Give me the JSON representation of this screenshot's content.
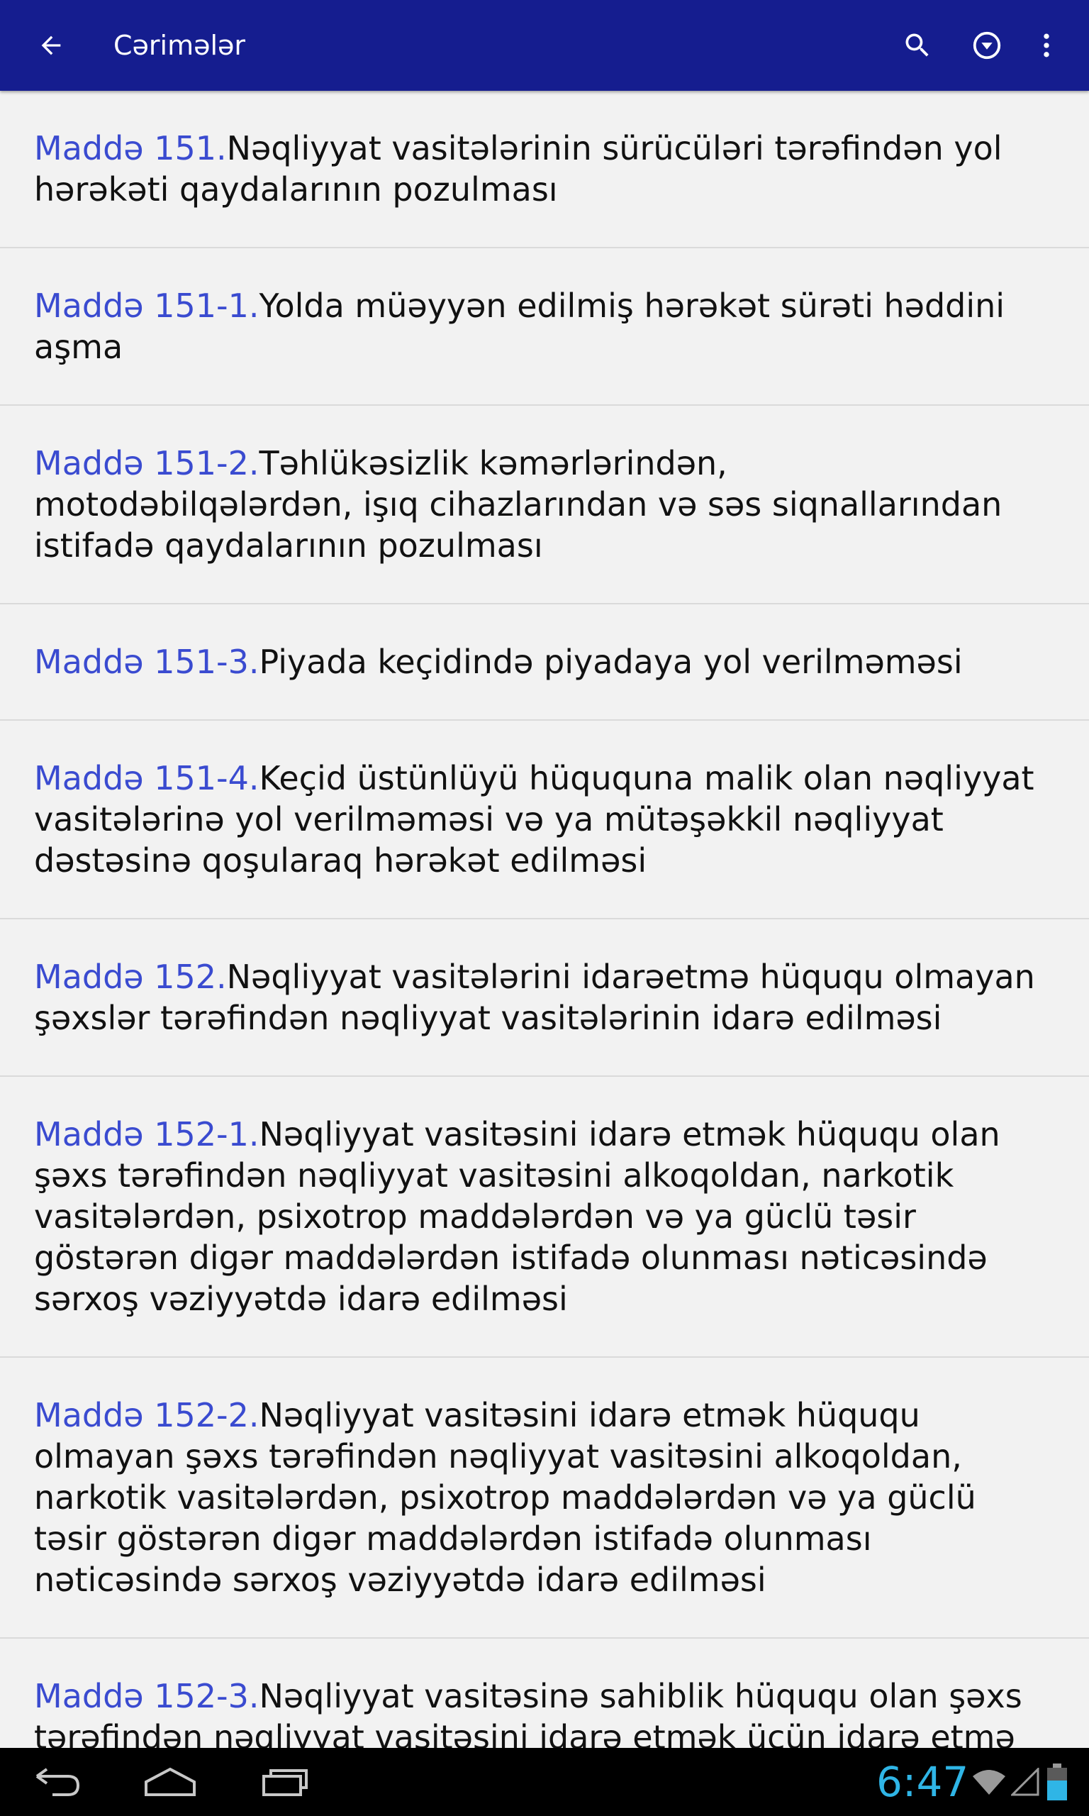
{
  "app_bar": {
    "title": "Cərimələr",
    "color": "#151d8f",
    "icons": [
      "back-arrow-icon",
      "search-icon",
      "filter-dropdown-icon",
      "more-vert-icon"
    ]
  },
  "articles": [
    {
      "number": "Maddə 151.",
      "text": "Nəqliyyat vasitələrinin sürücüləri tərəfindən yol hərəkəti qaydalarının pozulması"
    },
    {
      "number": "Maddə 151-1.",
      "text": "Yolda müəyyən edilmiş hərəkət sürəti həddini aşma"
    },
    {
      "number": "Maddə 151-2.",
      "text": "Təhlükəsizlik kəmərlərindən, motodəbilqələrdən, işıq cihazlarından və səs siqnallarından istifadə qaydalarının pozulması"
    },
    {
      "number": "Maddə 151-3.",
      "text": "Piyada keçidində piyadaya yol verilməməsi"
    },
    {
      "number": "Maddə 151-4.",
      "text": "Keçid üstünlüyü hüququna malik olan nəqliyyat vasitələrinə yol verilməməsi və ya mütəşəkkil nəqliyyat dəstəsinə qoşularaq hərəkət edilməsi"
    },
    {
      "number": "Maddə 152.",
      "text": "Nəqliyyat vasitələrini idarəetmə hüququ olmayan şəxslər tərəfindən nəqliyyat vasitələrinin idarə edilməsi"
    },
    {
      "number": "Maddə 152-1.",
      "text": "Nəqliyyat vasitəsini idarə etmək hüququ olan şəxs tərəfindən nəqliyyat vasitəsini alkoqoldan, narkotik vasitələrdən, psixotrop maddələrdən və ya güclü təsir göstərən digər maddələrdən istifadə olunması nəticəsində sərxoş vəziyyətdə idarə edilməsi"
    },
    {
      "number": "Maddə 152-2.",
      "text": "Nəqliyyat vasitəsini idarə etmək hüququ olmayan şəxs tərəfindən nəqliyyat vasitəsini alkoqoldan, narkotik vasitələrdən, psixotrop maddələrdən və ya güclü təsir göstərən digər maddələrdən istifadə olunması nəticəsində sərxoş vəziyyətdə idarə edilməsi"
    },
    {
      "number": "Maddə 152-3.",
      "text": "Nəqliyyat vasitəsinə sahiblik hüququ olan şəxs tərəfindən nəqliyyat vasitəsini idarə etmək üçün idarə etmə"
    }
  ],
  "accent_color": "#3a4bd0",
  "system_bar": {
    "time": "6:47",
    "icons": [
      "nav-back-icon",
      "nav-home-icon",
      "nav-recents-icon",
      "wifi-icon",
      "signal-icon",
      "battery-icon"
    ]
  }
}
